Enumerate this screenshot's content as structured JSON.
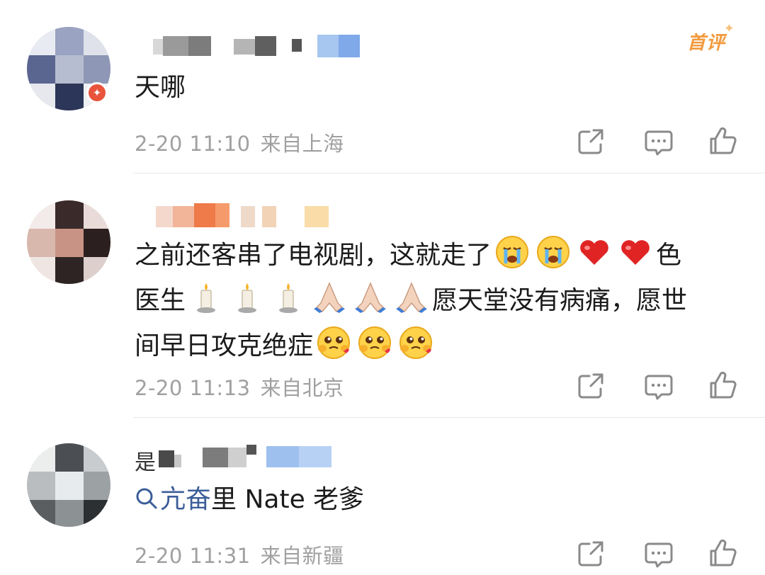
{
  "comments": [
    {
      "badge": "首评",
      "text": "天哪",
      "time": "2-20 11:10",
      "location": "来自上海"
    },
    {
      "text_line1": "之前还客串了电视剧，这就走了",
      "text_line1_end": "色",
      "text_line2_start": "医生",
      "text_line2_end": "愿天堂没有病痛，愿世",
      "text_line3": "间早日攻克绝症",
      "time": "2-20 11:13",
      "location": "来自北京"
    },
    {
      "name_prefix": "是",
      "search_text": "亢奋",
      "text": "里 Nate 老爹",
      "time": "2-20 11:31",
      "location": "来自新疆"
    }
  ],
  "icons": [
    "share-icon",
    "comment-icon",
    "like-icon",
    "search-icon"
  ],
  "colors": {
    "meta_gray": "#a0a0a0",
    "badge_orange": "#f29a3d",
    "link_blue": "#3b5d99",
    "verified_red": "#e8543c"
  }
}
